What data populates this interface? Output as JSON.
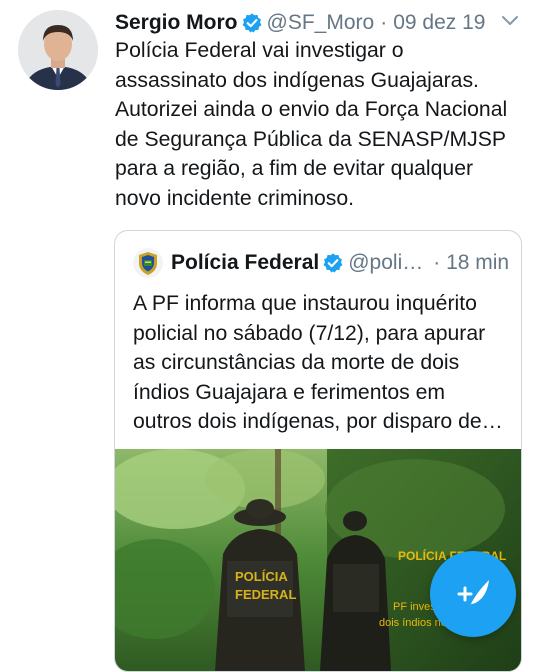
{
  "tweet": {
    "author_name": "Sergio Moro",
    "handle": "@SF_Moro",
    "separator": "·",
    "date": "09 dez 19",
    "lines": [
      "Polícia Federal vai investigar o",
      "assassinato dos indígenas Guajajaras.",
      "Autorizei ainda o envio da Força Nacional",
      "de Segurança Pública da SENASP/MJSP",
      "para a região, a fim de evitar qualquer",
      "novo incidente criminoso."
    ]
  },
  "quoted_tweet": {
    "author_name": "Polícia Federal",
    "handle": "@poli…",
    "time": "· 18 min",
    "lines": [
      "A PF informa que instaurou inquérito",
      "policial no sábado (7/12), para apurar",
      "as circunstâncias da morte de dois",
      "índios Guajajara e ferimentos em",
      "outros dois indígenas, por disparo de…"
    ],
    "media": {
      "vest_text_1": "POLÍCIA",
      "vest_text_2": "FEDERAL",
      "overlay_title": "POLÍCIA FEDERAL",
      "overlay_line_1": "PF inves",
      "overlay_line_2": "dois índios no m"
    }
  },
  "colors": {
    "accent": "#1da1f2",
    "verified": "#1da1f2",
    "secondary_text": "#657786",
    "border": "#ccd6dd"
  },
  "icons": {
    "verified": "verified-badge-icon",
    "caret": "chevron-down-icon",
    "compose": "compose-tweet-icon"
  }
}
